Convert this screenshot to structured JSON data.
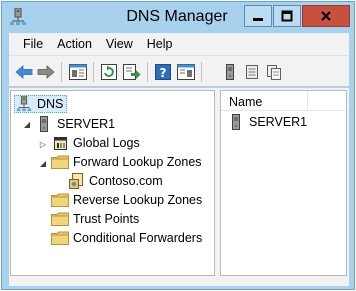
{
  "window": {
    "title": "DNS Manager"
  },
  "menu": [
    "File",
    "Action",
    "View",
    "Help"
  ],
  "toolbar_icons": [
    "back-arrow-icon",
    "forward-arrow-icon",
    "console-tree-icon",
    "refresh-icon",
    "export-icon",
    "help-icon",
    "properties-icon",
    "server-icon",
    "zone-icon",
    "copy-icon"
  ],
  "tree": {
    "root": "DNS",
    "server": "SERVER1",
    "global_logs": "Global Logs",
    "forward_zones": "Forward Lookup Zones",
    "zone": "Contoso.com",
    "reverse_zones": "Reverse Lookup Zones",
    "trust_points": "Trust Points",
    "conditional_forwarders": "Conditional Forwarders"
  },
  "list": {
    "column_name": "Name",
    "items": [
      "SERVER1"
    ]
  },
  "colors": {
    "frame": "#a7d1ec",
    "close_button": "#c7503e",
    "folder": "#e8c764"
  }
}
